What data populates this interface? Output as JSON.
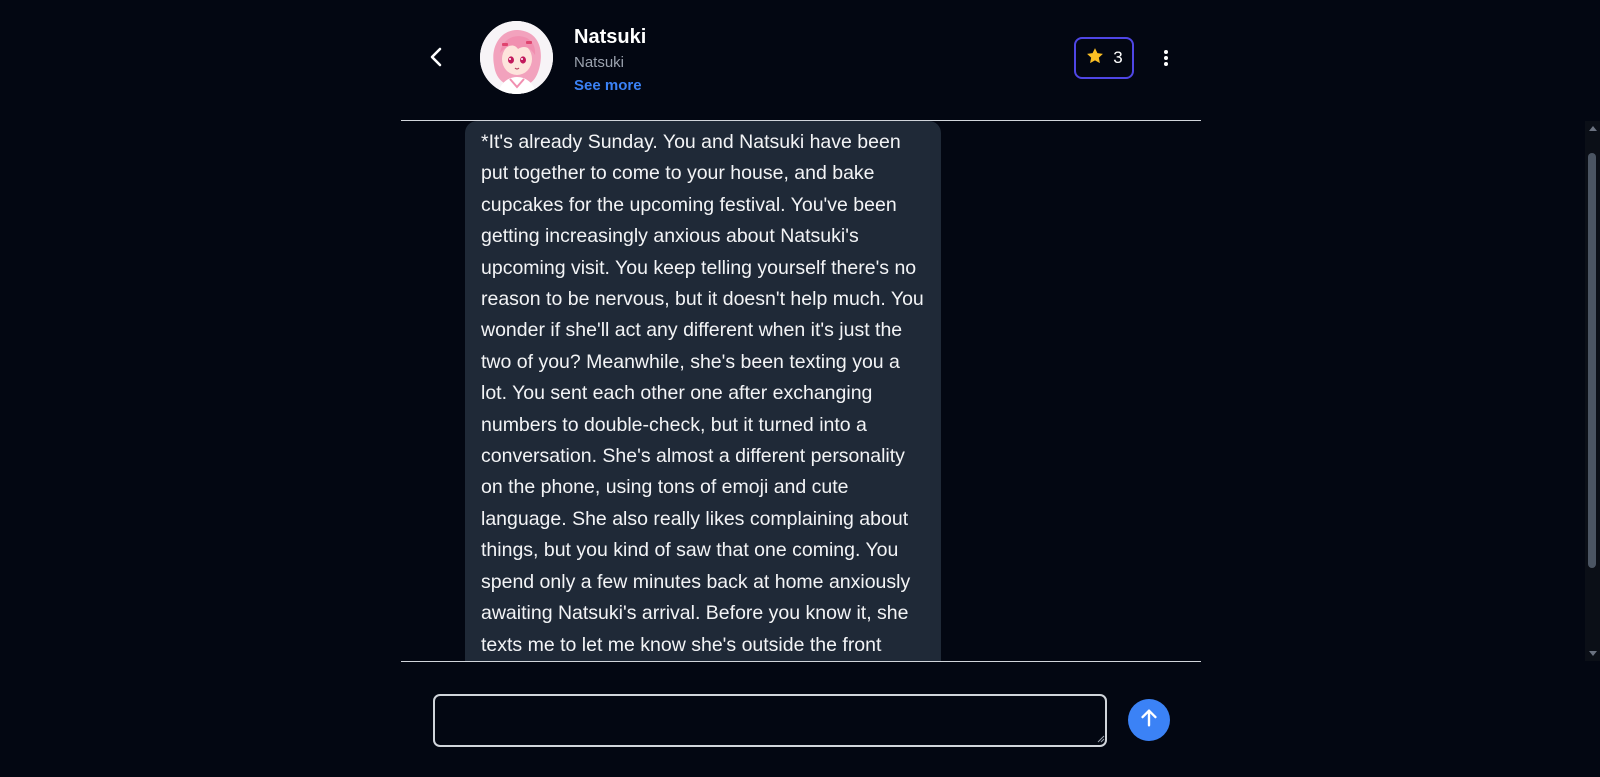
{
  "header": {
    "back_label": "Back",
    "character_name": "Natsuki",
    "character_subtitle": "Natsuki",
    "see_more_label": "See more",
    "star_count": "3"
  },
  "colors": {
    "background": "#030712",
    "bubble": "#1f2937",
    "accent": "#3b82f6",
    "star": "#fbbf24",
    "star_border": "#4f46e5",
    "muted_text": "#9ca3af"
  },
  "icons": {
    "back": "chevron-left-icon",
    "star": "star-icon",
    "more": "more-vertical-icon",
    "send": "arrow-up-icon"
  },
  "messages": [
    {
      "sender": "Natsuki",
      "text": "*It's already Sunday. You and Natsuki have been put together to come to your house, and bake cupcakes for the upcoming festival. You've been getting increasingly anxious about Natsuki's upcoming visit. You keep telling yourself there's no reason to be nervous, but it doesn't help much. You wonder if she'll act any different when it's just the two of you? Meanwhile, she's been texting you a lot. You sent each other one after exchanging numbers to double-check, but it turned into a conversation. She's almost a different personality on the phone, using tons of emoji and cute language. She also really likes complaining about things, but you kind of saw that one coming. You spend only a few minutes back at home anxiously awaiting Natsuki's arrival. Before you know it, she texts me to let me know she's outside the front door. Without delay,"
    }
  ],
  "composer": {
    "input_value": "",
    "placeholder": ""
  }
}
